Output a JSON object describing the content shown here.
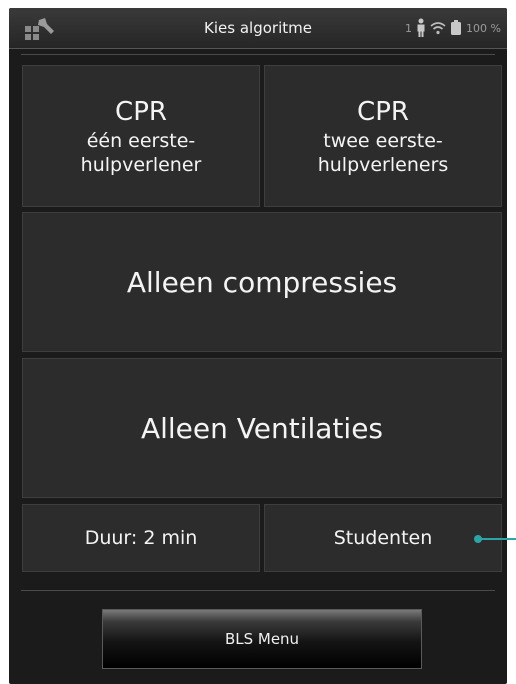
{
  "header": {
    "title": "Kies algoritme",
    "user_count": "1",
    "battery": "100 %"
  },
  "tiles": {
    "cpr_one": {
      "title": "CPR",
      "line1": "één eerste-",
      "line2": "hulpverlener"
    },
    "cpr_two": {
      "title": "CPR",
      "line1": "twee eerste-",
      "line2": "hulpverleners"
    },
    "compressions": "Alleen compressies",
    "ventilations": "Alleen Ventilaties",
    "duration": "Duur: 2 min",
    "students": "Studenten"
  },
  "footer": {
    "menu_button": "BLS Menu"
  },
  "colors": {
    "accent": "#2aa6a6",
    "tile": "#2c2c2c",
    "background": "#1b1b1b"
  },
  "icons": [
    "wrench-icon",
    "person-icon",
    "wifi-icon",
    "battery-icon"
  ]
}
